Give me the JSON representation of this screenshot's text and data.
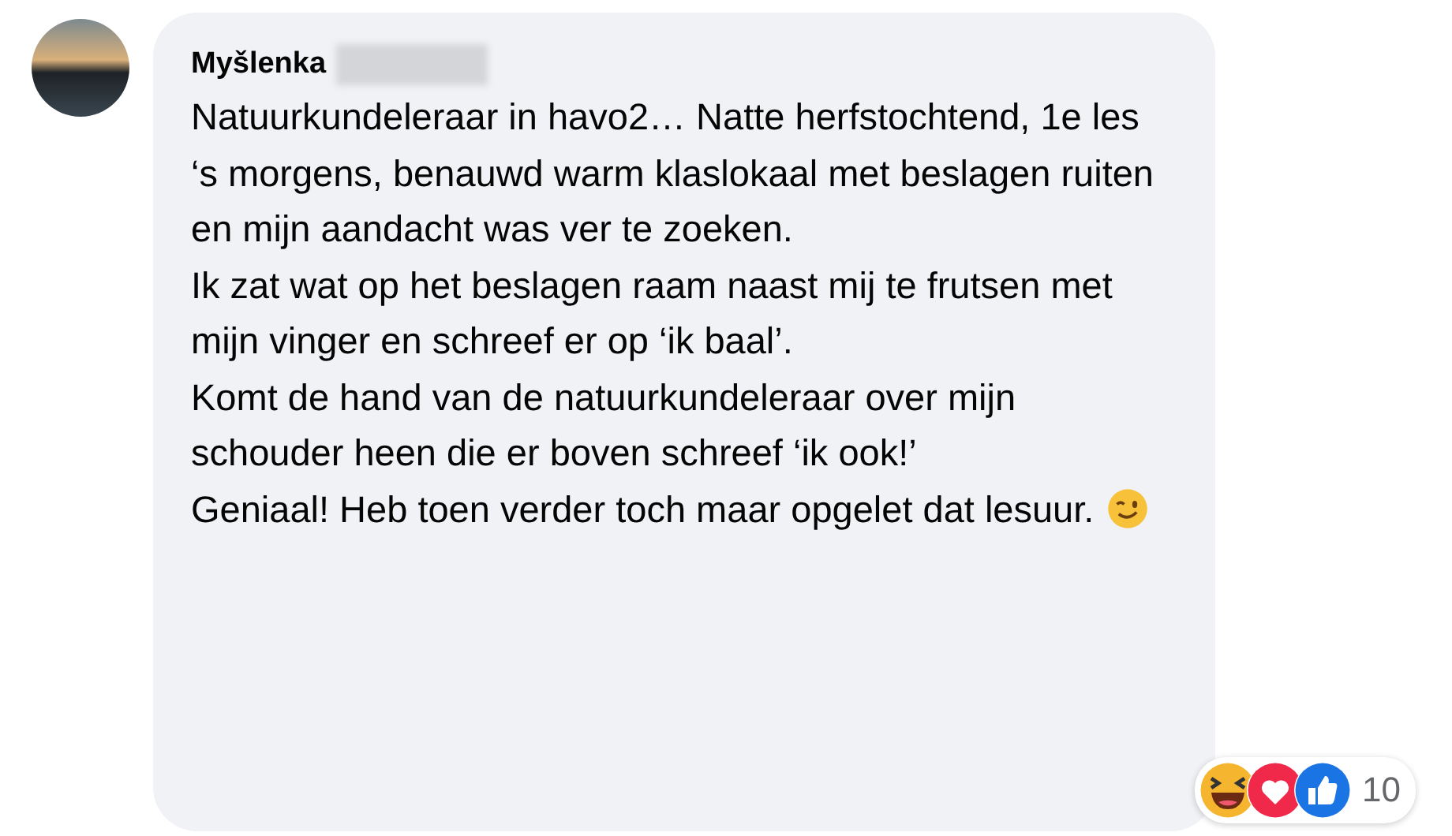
{
  "comment": {
    "author": "Myšlenka",
    "paragraphs": [
      "Natuurkundeleraar in havo2… Natte herfstochtend, 1e les ‘s morgens, benauwd warm klaslokaal met beslagen ruiten en mijn aandacht was ver te zoeken.",
      "Ik zat wat op het beslagen raam naast mij te frutsen met mijn vinger en schreef er op ‘ik baal’.",
      "Komt de hand van de natuurkundeleraar over mijn schouder heen die er boven schreef ‘ik ook!’",
      "Geniaal! Heb toen verder toch maar opgelet dat lesuur."
    ],
    "reactions": {
      "count": "10"
    }
  }
}
